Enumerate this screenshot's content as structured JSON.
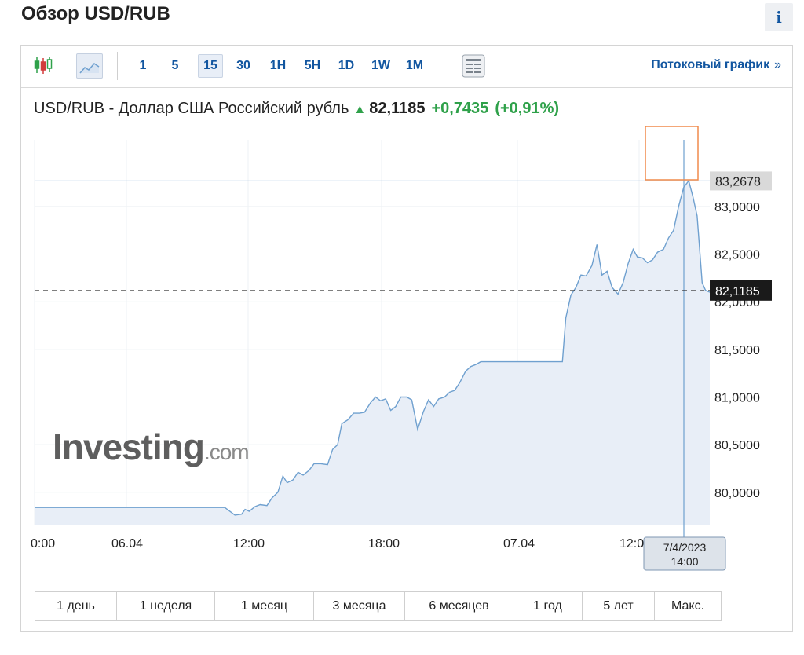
{
  "page": {
    "title": "Обзор USD/RUB",
    "info_label": "i"
  },
  "toolbar": {
    "intervals": [
      "1",
      "5",
      "15",
      "30",
      "1H",
      "5H",
      "1D",
      "1W",
      "1M"
    ],
    "active_interval": "15",
    "streaming_link": "Потоковый график",
    "streaming_chevron": "»"
  },
  "quote": {
    "name": "USD/RUB - Доллар США Российский рубль",
    "price": "82,1185",
    "change": "+0,7435",
    "change_pct": "(+0,91%)"
  },
  "colors": {
    "line": "#6fa0cf",
    "area": "#e8eef7",
    "grid": "#eef1f4",
    "accent": "#1256a0",
    "positive": "#2fa14a",
    "highlight": "#f08a4b"
  },
  "watermark": {
    "brand": "Investing",
    "suffix": ".com"
  },
  "ranges": [
    "1 день",
    "1 неделя",
    "1 месяц",
    "3 месяца",
    "6 месяцев",
    "1 год",
    "5 лет",
    "Макс."
  ],
  "chart_data": {
    "type": "area",
    "title": "USD/RUB - Доллар США Российский рубль",
    "xlabel": "",
    "ylabel": "",
    "x_ticks": [
      {
        "label": "0:00",
        "t": -24
      },
      {
        "label": "06.04",
        "t": 0
      },
      {
        "label": "12:00",
        "t": 12
      },
      {
        "label": "18:00",
        "t": 24
      },
      {
        "label": "07.04",
        "t": 36
      },
      {
        "label": "12:00",
        "t": 48
      }
    ],
    "y_ticks": [
      "80,0000",
      "80,5000",
      "81,0000",
      "81,5000",
      "82,0000",
      "82,5000",
      "83,0000"
    ],
    "ylim": [
      79.66,
      83.7
    ],
    "xlim_hours": [
      -24.4,
      50.5
    ],
    "current_price": {
      "label": "82,1185",
      "value": 82.1185
    },
    "crosshair": {
      "value_label": "83,2678",
      "value": 83.2678,
      "date": "7/4/2023",
      "time": "14:00",
      "t": 49.2
    },
    "series": [
      {
        "points": [
          [
            -24.4,
            79.84
          ],
          [
            -21.6,
            79.84
          ],
          [
            -3.6,
            79.84
          ],
          [
            -1.8,
            79.84
          ],
          [
            -0.6,
            79.76
          ],
          [
            0.2,
            79.77
          ],
          [
            0.6,
            79.82
          ],
          [
            1.1,
            79.8
          ],
          [
            1.8,
            79.85
          ],
          [
            2.4,
            79.87
          ],
          [
            3.2,
            79.86
          ],
          [
            3.8,
            79.94
          ],
          [
            4.5,
            80.0
          ],
          [
            5.1,
            80.17
          ],
          [
            5.6,
            80.1
          ],
          [
            6.3,
            80.13
          ],
          [
            6.9,
            80.21
          ],
          [
            7.5,
            80.18
          ],
          [
            8.2,
            80.23
          ],
          [
            8.8,
            80.3
          ],
          [
            9.6,
            80.3
          ],
          [
            10.4,
            80.29
          ],
          [
            11.0,
            80.45
          ],
          [
            11.6,
            80.5
          ],
          [
            12.1,
            80.72
          ],
          [
            12.8,
            80.76
          ],
          [
            13.5,
            80.83
          ],
          [
            14.2,
            80.83
          ],
          [
            14.8,
            80.84
          ],
          [
            15.5,
            80.94
          ],
          [
            16.1,
            81.0
          ],
          [
            16.7,
            80.96
          ],
          [
            17.3,
            80.98
          ],
          [
            17.9,
            80.86
          ],
          [
            18.5,
            80.9
          ],
          [
            19.1,
            81.0
          ],
          [
            19.8,
            81.0
          ],
          [
            20.4,
            80.97
          ],
          [
            21.1,
            80.66
          ],
          [
            21.8,
            80.85
          ],
          [
            22.4,
            80.97
          ],
          [
            23.0,
            80.9
          ],
          [
            23.6,
            80.98
          ],
          [
            24.3,
            81.0
          ],
          [
            24.9,
            81.05
          ],
          [
            25.5,
            81.07
          ],
          [
            26.1,
            81.15
          ],
          [
            26.8,
            81.27
          ],
          [
            27.4,
            81.32
          ],
          [
            28.0,
            81.34
          ],
          [
            28.6,
            81.37
          ],
          [
            33.0,
            81.37
          ],
          [
            36.0,
            81.37
          ],
          [
            38.3,
            81.37
          ],
          [
            38.7,
            81.83
          ],
          [
            39.3,
            82.07
          ],
          [
            39.9,
            82.15
          ],
          [
            40.5,
            82.28
          ],
          [
            41.1,
            82.27
          ],
          [
            41.8,
            82.38
          ],
          [
            42.4,
            82.6
          ],
          [
            43.0,
            82.28
          ],
          [
            43.6,
            82.32
          ],
          [
            44.2,
            82.15
          ],
          [
            44.9,
            82.08
          ],
          [
            45.5,
            82.2
          ],
          [
            46.1,
            82.4
          ],
          [
            46.7,
            82.55
          ],
          [
            47.2,
            82.47
          ],
          [
            47.8,
            82.46
          ],
          [
            48.4,
            82.41
          ],
          [
            49.0,
            82.44
          ],
          [
            49.6,
            82.52
          ],
          [
            50.3,
            82.55
          ],
          [
            50.9,
            82.67
          ],
          [
            51.5,
            82.75
          ],
          [
            52.1,
            83.0
          ],
          [
            52.7,
            83.2
          ],
          [
            53.3,
            83.27
          ],
          [
            53.8,
            83.1
          ],
          [
            54.3,
            82.9
          ],
          [
            54.9,
            82.2
          ],
          [
            55.3,
            82.12
          ],
          [
            55.8,
            82.1
          ]
        ]
      }
    ]
  }
}
